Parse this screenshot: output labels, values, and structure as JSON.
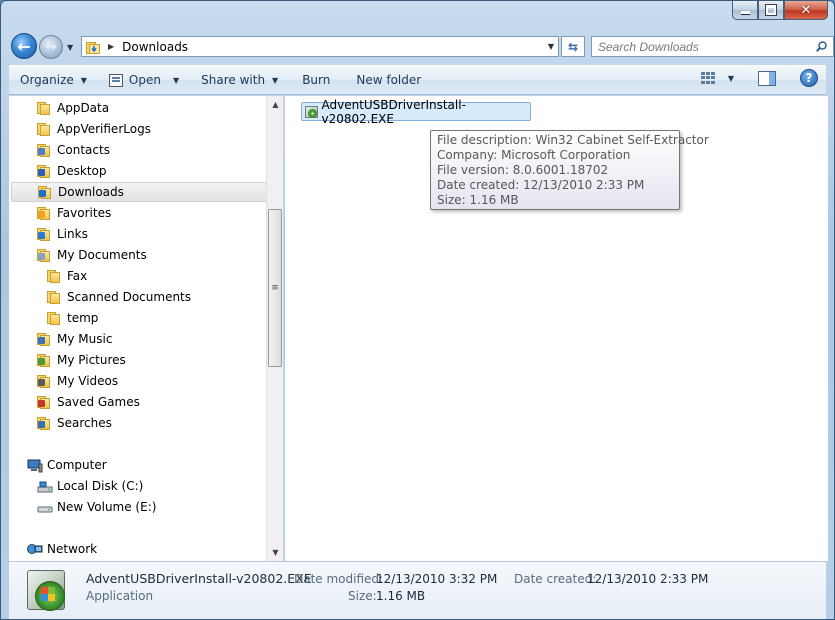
{
  "window": {
    "title": "Downloads"
  },
  "caption": {
    "minimize": "minimize",
    "maximize": "maximize",
    "close": "close"
  },
  "address": {
    "path": "Downloads"
  },
  "search": {
    "placeholder": "Search Downloads"
  },
  "toolbar": {
    "organize": "Organize",
    "open": "Open",
    "share_with": "Share with",
    "burn": "Burn",
    "new_folder": "New folder"
  },
  "nav": {
    "items": [
      {
        "label": "AppData",
        "icon": "folder-icon"
      },
      {
        "label": "AppVerifierLogs",
        "icon": "folder-icon"
      },
      {
        "label": "Contacts",
        "icon": "contacts-folder-icon"
      },
      {
        "label": "Desktop",
        "icon": "desktop-folder-icon"
      },
      {
        "label": "Downloads",
        "icon": "downloads-folder-icon",
        "selected": true
      },
      {
        "label": "Favorites",
        "icon": "favorites-folder-icon"
      },
      {
        "label": "Links",
        "icon": "links-folder-icon"
      },
      {
        "label": "My Documents",
        "icon": "documents-folder-icon"
      },
      {
        "label": "Fax",
        "icon": "folder-icon"
      },
      {
        "label": "Scanned Documents",
        "icon": "folder-icon"
      },
      {
        "label": "temp",
        "icon": "folder-icon"
      },
      {
        "label": "My Music",
        "icon": "music-folder-icon"
      },
      {
        "label": "My Pictures",
        "icon": "pictures-folder-icon"
      },
      {
        "label": "My Videos",
        "icon": "videos-folder-icon"
      },
      {
        "label": "Saved Games",
        "icon": "games-folder-icon"
      },
      {
        "label": "Searches",
        "icon": "searches-folder-icon"
      },
      {
        "label": "Computer",
        "icon": "computer-icon"
      },
      {
        "label": "Local Disk (C:)",
        "icon": "local-disk-icon"
      },
      {
        "label": "New Volume (E:)",
        "icon": "drive-icon"
      },
      {
        "label": "Network",
        "icon": "network-icon"
      }
    ]
  },
  "content": {
    "file_name": "AdventUSBDriverInstall-v20802.EXE",
    "tooltip": {
      "description": "File description: Win32 Cabinet Self-Extractor",
      "company": "Company: Microsoft Corporation",
      "version": "File version: 8.0.6001.18702",
      "created": "Date created: 12/13/2010 2:33 PM",
      "size": "Size: 1.16 MB"
    }
  },
  "details": {
    "name": "AdventUSBDriverInstall-v20802.EXE",
    "type": "Application",
    "modified_label": "Date modified:",
    "modified_value": "12/13/2010 3:32 PM",
    "created_label": "Date created:",
    "created_value": "12/13/2010 2:33 PM",
    "size_label": "Size:",
    "size_value": "1.16 MB"
  }
}
